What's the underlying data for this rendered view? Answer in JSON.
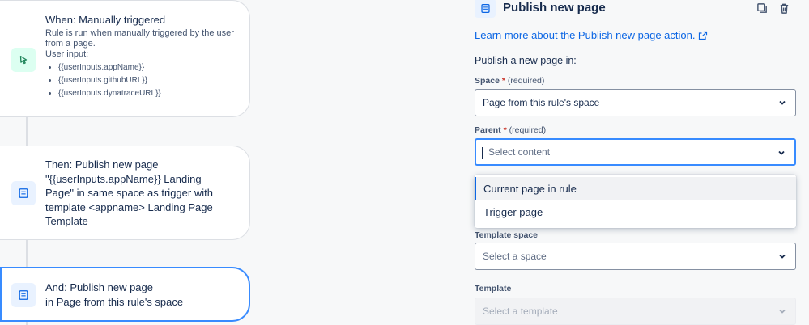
{
  "canvas": {
    "trigger": {
      "title": "When: Manually triggered",
      "description": "Rule is run when manually triggered by the user from a page.",
      "user_input_label": "User input:",
      "inputs": [
        "{{userInputs.appName}}",
        "{{userInputs.githubURL}}",
        "{{userInputs.dynatraceURL}}"
      ],
      "icon": "cursor-click-icon"
    },
    "action1": {
      "lines": [
        "Then: Publish new page",
        "\"{{userInputs.appName}} Landing",
        "Page\" in same space as trigger with",
        "template <appname> Landing Page",
        "Template"
      ],
      "icon": "page-icon"
    },
    "action2": {
      "lines": [
        "And: Publish new page",
        "in Page from this rule's space"
      ],
      "icon": "page-icon"
    }
  },
  "panel": {
    "title": "Publish new page",
    "learn_link": "Learn more about the Publish new page action.",
    "section_title": "Publish a new page in:",
    "space": {
      "label": "Space",
      "required_marker": "*",
      "required_text": "(required)",
      "value": "Page from this rule's space"
    },
    "parent": {
      "label": "Parent",
      "required_marker": "*",
      "required_text": "(required)",
      "placeholder": "Select content"
    },
    "parent_options": [
      "Current page in rule",
      "Trigger page"
    ],
    "template_space": {
      "label": "Template space",
      "placeholder": "Select a space"
    },
    "template": {
      "label": "Template",
      "placeholder": "Select a template"
    }
  },
  "colors": {
    "accent": "#388bff",
    "link": "#0c66e4",
    "required": "#c9372c"
  }
}
